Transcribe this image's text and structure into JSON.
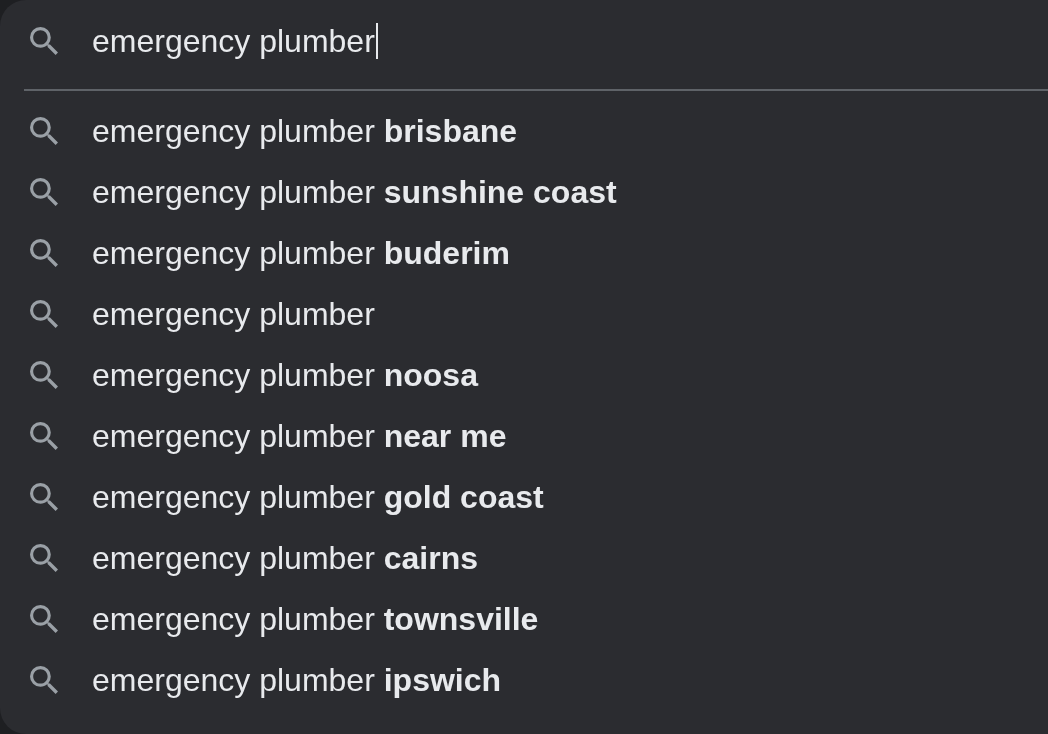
{
  "search": {
    "value": "emergency plumber",
    "focused": true
  },
  "suggestions": [
    {
      "text": "emergency plumber **brisbane**"
    },
    {
      "text": "emergency plumber **sunshine coast**"
    },
    {
      "text": "emergency plumber **buderim**"
    },
    {
      "text": "emergency plumber"
    },
    {
      "text": "emergency plumber **noosa**"
    },
    {
      "text": "emergency plumber **near me**"
    },
    {
      "text": "emergency plumber **gold coast**"
    },
    {
      "text": "emergency plumber **cairns**"
    },
    {
      "text": "emergency plumber **townsville**"
    },
    {
      "text": "emergency plumber **ipswich**"
    }
  ]
}
